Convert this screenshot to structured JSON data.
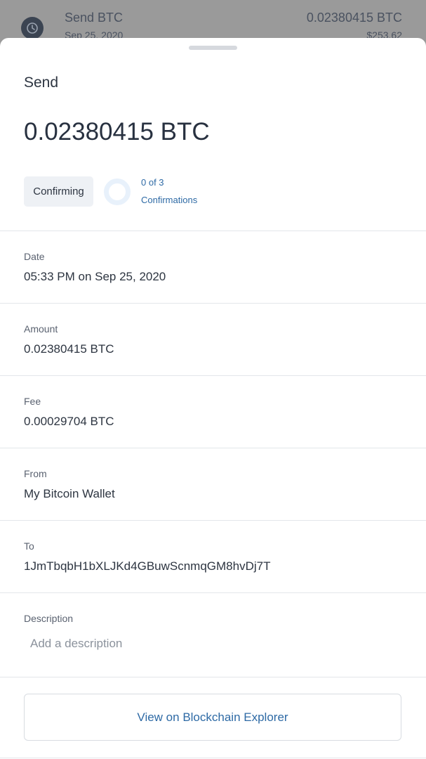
{
  "background_list": {
    "item_title": "Send BTC",
    "item_date": "Sep 25, 2020",
    "item_amount": "0.02380415 BTC",
    "item_fiat": "$253.62",
    "icon": "clock-icon"
  },
  "sheet": {
    "title": "Send",
    "amount": "0.02380415 BTC",
    "status": {
      "label": "Confirming",
      "confirmations_count": "0 of 3",
      "confirmations_label": "Confirmations",
      "progress": 0
    },
    "fields": {
      "date": {
        "label": "Date",
        "value": "05:33 PM on Sep 25, 2020"
      },
      "amount": {
        "label": "Amount",
        "value": "0.02380415 BTC"
      },
      "fee": {
        "label": "Fee",
        "value": "0.00029704 BTC"
      },
      "from": {
        "label": "From",
        "value": "My Bitcoin Wallet"
      },
      "to": {
        "label": "To",
        "value": "1JmTbqbH1bXLJKd4GBuwScnmqGM8hvDj7T"
      },
      "description": {
        "label": "Description",
        "value": "",
        "placeholder": "Add a description"
      }
    },
    "explorer_button": "View on Blockchain Explorer"
  },
  "colors": {
    "accent": "#2e6aa5",
    "text": "#2d3541",
    "overlay": "#8e8e8e"
  }
}
